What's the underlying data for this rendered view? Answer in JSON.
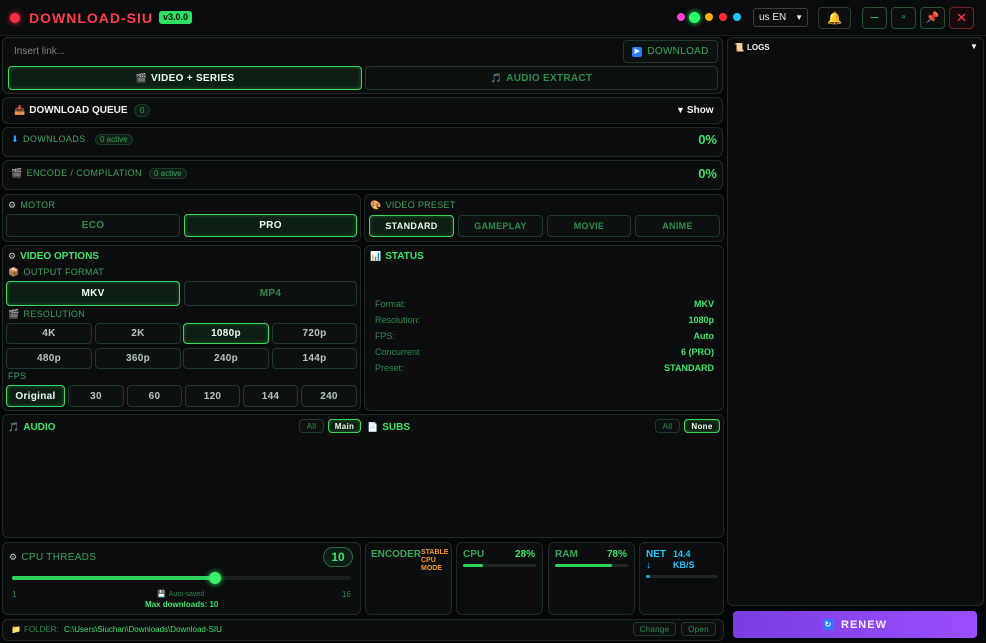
{
  "titlebar": {
    "app_name": "DOWNLOAD-SIU",
    "version": "v3.0.0",
    "language": "us EN",
    "dot_colors": [
      "#ff3fd6",
      "#2bff6a",
      "#ffb000",
      "#ff2b3a",
      "#1ec8ff"
    ]
  },
  "link_bar": {
    "placeholder": "Insert link...",
    "download_label": "DOWNLOAD",
    "tab_video": "VIDEO + SERIES",
    "tab_audio": "AUDIO EXTRACT"
  },
  "queue": {
    "title": "DOWNLOAD QUEUE",
    "count": "0",
    "toggle": "Show"
  },
  "downloads": {
    "title": "DOWNLOADS",
    "badge": "0 active",
    "percent": "0%"
  },
  "encode": {
    "title": "ENCODE / COMPILATION",
    "badge": "0 active",
    "percent": "0%"
  },
  "motor": {
    "title": "MOTOR",
    "options": [
      "ECO",
      "PRO"
    ],
    "selected": "PRO"
  },
  "preset": {
    "title": "VIDEO PRESET",
    "options": [
      "STANDARD",
      "GAMEPLAY",
      "MOVIE",
      "ANIME"
    ],
    "selected": "STANDARD"
  },
  "video_options": {
    "title": "VIDEO OPTIONS",
    "output_format_label": "OUTPUT FORMAT",
    "formats": [
      "MKV",
      "MP4"
    ],
    "format_selected": "MKV",
    "resolution_label": "RESOLUTION",
    "resolutions": [
      "4K",
      "2K",
      "1080p",
      "720p",
      "480p",
      "360p",
      "240p",
      "144p"
    ],
    "resolution_selected": "1080p",
    "fps_label": "FPS",
    "fps": [
      "Original",
      "30",
      "60",
      "120",
      "144",
      "240"
    ],
    "fps_selected": "Original"
  },
  "status": {
    "title": "STATUS",
    "rows": [
      {
        "key": "Format:",
        "value": "MKV"
      },
      {
        "key": "Resolution:",
        "value": "1080p"
      },
      {
        "key": "FPS:",
        "value": "Auto"
      },
      {
        "key": "Concurrent",
        "value": "6 (PRO)"
      },
      {
        "key": "Preset:",
        "value": "STANDARD"
      }
    ]
  },
  "audio": {
    "title": "AUDIO",
    "all": "All",
    "main": "Main"
  },
  "subs": {
    "title": "SUBS",
    "all": "All",
    "none": "None"
  },
  "cpu_threads": {
    "title": "CPU THREADS",
    "value": "10",
    "min": "1",
    "max": "16",
    "slider_fraction": 0.6,
    "autosaved": "Auto-saved",
    "max_downloads": "Max downloads: 10"
  },
  "encoder": {
    "title": "ENCODER",
    "mode_line1": "STABLE",
    "mode_line2": "CPU",
    "mode_line3": "MODE"
  },
  "cpu": {
    "title": "CPU",
    "percent": "28%",
    "fraction": 0.28
  },
  "ram": {
    "title": "RAM",
    "percent": "78%",
    "fraction": 0.78
  },
  "net": {
    "title": "NET",
    "arrow": "↓",
    "value_line1": "14.4",
    "value_line2": "KB/S",
    "fraction": 0.05
  },
  "folder": {
    "label": "FOLDER:",
    "path": "C:\\Users\\Siuchan\\Downloads\\Download-SIU",
    "change": "Change",
    "open": "Open"
  },
  "logs": {
    "title": "LOGS"
  },
  "renew": {
    "label": "RENEW"
  }
}
